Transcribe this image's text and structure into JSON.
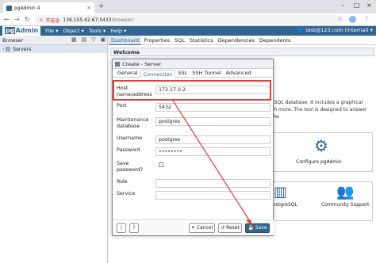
{
  "window": {
    "tab_title": "pgAdmin 4",
    "url_warning": "⚠",
    "url_insecure": "不安全",
    "url_host": "139.155.42.67:5433",
    "url_path": "/browser/"
  },
  "navbar": {
    "logo_pg": "pg",
    "logo_admin": "Admin",
    "menus": [
      "File ▾",
      "Object ▾",
      "Tools ▾",
      "Help ▾"
    ],
    "user": "👤 test@123.com (internal) ▾"
  },
  "browser": {
    "title": "Browser",
    "tree_item": "Servers"
  },
  "main_tabs": [
    "Dashboard",
    "Properties",
    "SQL",
    "Statistics",
    "Dependencies",
    "Dependents"
  ],
  "dashboard": {
    "welcome": "Welcome",
    "intro_line1": "eSQL database. It includes a graphical",
    "intro_line2": "ch more. The tool is designed to answer the",
    "card1_label": "Configure pgAdmin",
    "card2_label": "ostgreSQL",
    "card3_label": "Community Support"
  },
  "dialog": {
    "title": "Create - Server",
    "tabs": [
      "General",
      "Connection",
      "SSL",
      "SSH Tunnel",
      "Advanced"
    ],
    "fields": {
      "host_label": "Host name/address",
      "host_value": "172.17.0.2",
      "port_label": "Port",
      "port_value": "5432",
      "maint_label": "Maintenance database",
      "maint_value": "postgres",
      "user_label": "Username",
      "user_value": "postgres",
      "pass_label": "Password",
      "pass_value": "••••••••",
      "save_label": "Save password?",
      "role_label": "Role",
      "service_label": "Service"
    },
    "buttons": {
      "info": "i",
      "help": "?",
      "cancel": "✕ Cancel",
      "reset": "↺ Reset",
      "save": "💾 Save"
    }
  },
  "colors": {
    "brand": "#326690",
    "annotation": "#e23d3d"
  }
}
